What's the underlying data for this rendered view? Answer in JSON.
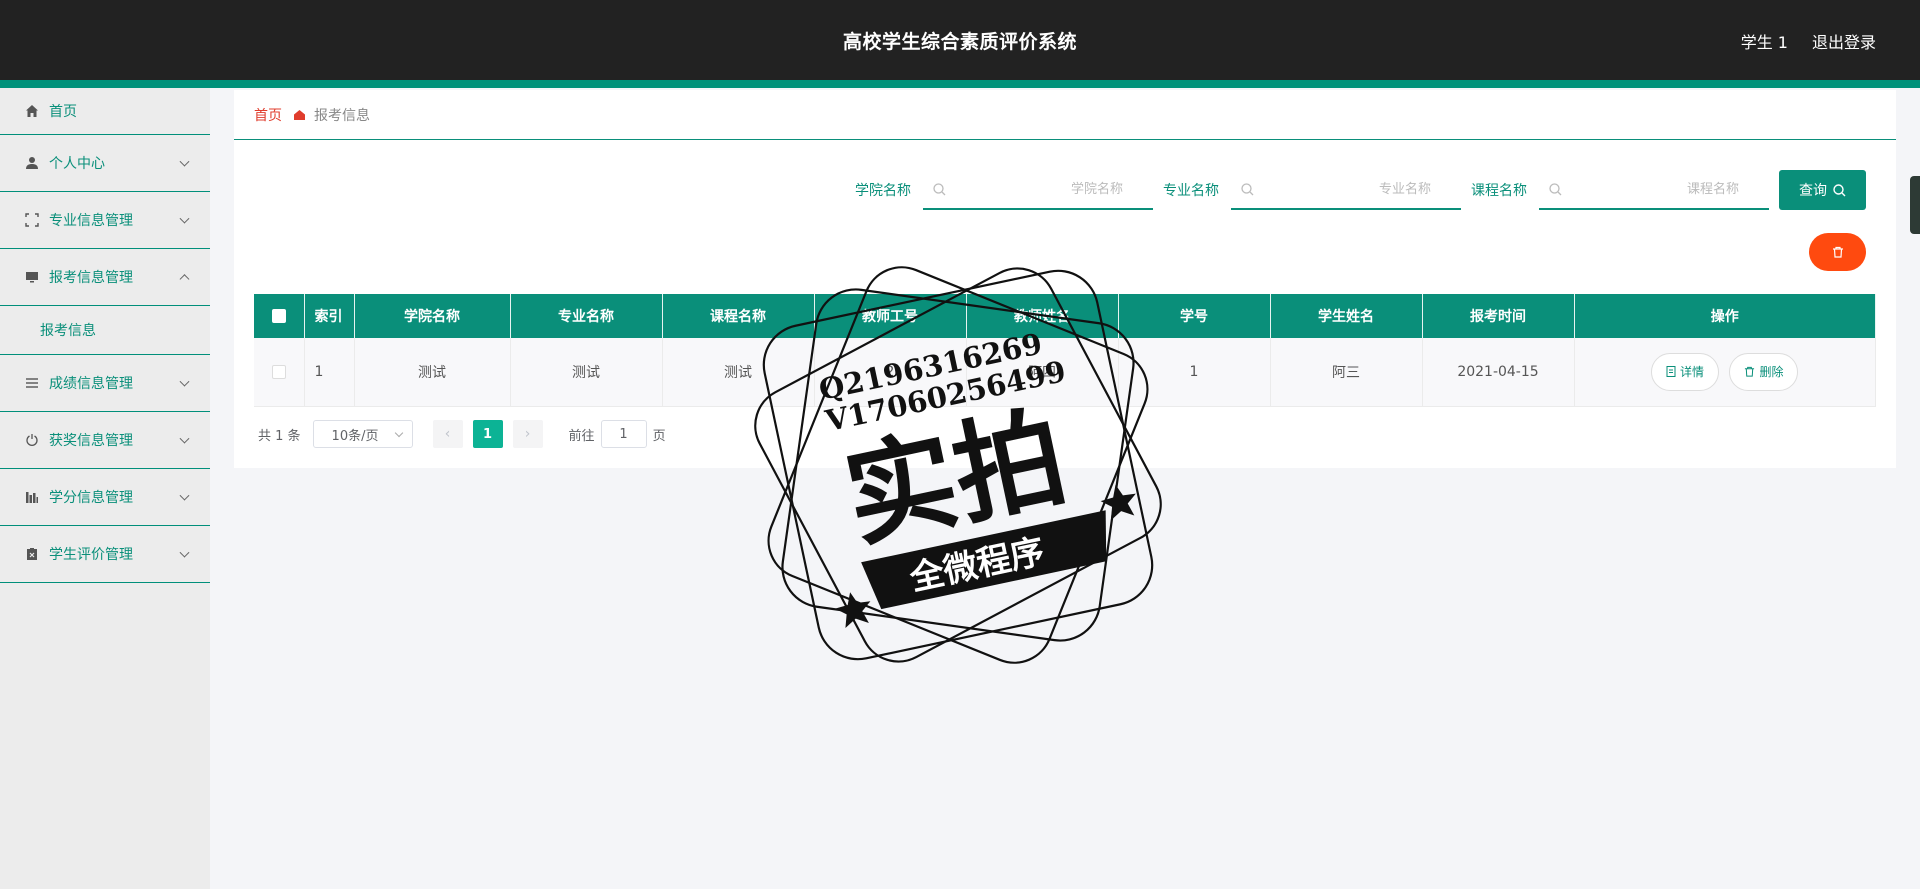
{
  "header": {
    "title": "高校学生综合素质评价系统",
    "user": "学生 1",
    "logout": "退出登录"
  },
  "sidebar": {
    "items": [
      {
        "label": "首页",
        "icon": "home-icon"
      },
      {
        "label": "个人中心",
        "icon": "user-icon"
      },
      {
        "label": "专业信息管理",
        "icon": "frame-icon"
      },
      {
        "label": "报考信息管理",
        "icon": "monitor-icon",
        "expanded": true,
        "children": [
          {
            "label": "报考信息"
          }
        ]
      },
      {
        "label": "成绩信息管理",
        "icon": "list-icon"
      },
      {
        "label": "获奖信息管理",
        "icon": "power-icon"
      },
      {
        "label": "学分信息管理",
        "icon": "chart-icon"
      },
      {
        "label": "学生评价管理",
        "icon": "clipboard-icon"
      }
    ]
  },
  "breadcrumb": {
    "home": "首页",
    "current": "报考信息"
  },
  "search": {
    "fields": [
      {
        "label": "学院名称",
        "placeholder": "学院名称"
      },
      {
        "label": "专业名称",
        "placeholder": "专业名称"
      },
      {
        "label": "课程名称",
        "placeholder": "课程名称"
      }
    ],
    "query_label": "查询"
  },
  "table": {
    "headers": [
      "索引",
      "学院名称",
      "专业名称",
      "课程名称",
      "教师工号",
      "教师姓名",
      "学号",
      "学生姓名",
      "报考时间",
      "操作"
    ],
    "rows": [
      [
        "1",
        "测试",
        "测试",
        "测试",
        "2",
        "阿四",
        "1",
        "阿三",
        "2021-04-15"
      ]
    ],
    "detail_label": "详情",
    "delete_label": "删除"
  },
  "pagination": {
    "total": "共 1 条",
    "page_size": "10条/页",
    "current_page": "1",
    "goto_prefix": "前往",
    "goto_value": "1",
    "goto_suffix": "页"
  },
  "watermark": {
    "line1": "Q2196316269",
    "line2": "V17060256499",
    "main": "实拍",
    "banner": "全微程序"
  },
  "colors": {
    "primary": "#0a8f7a",
    "header_bg": "#222222",
    "danger": "#ff4a0f",
    "breadcrumb_home": "#e03c2c"
  }
}
